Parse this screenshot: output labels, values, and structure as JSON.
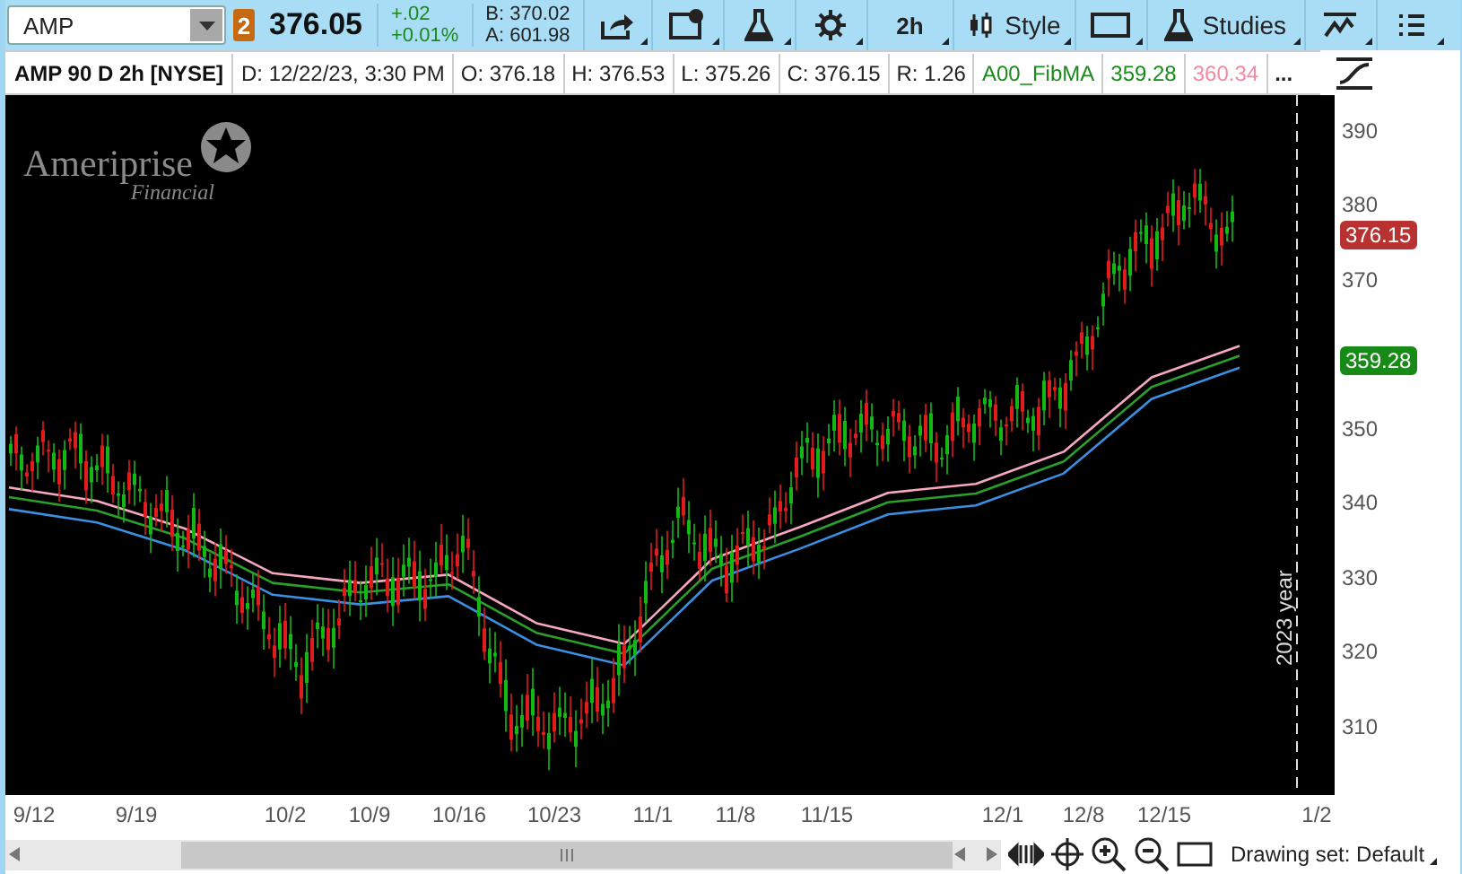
{
  "toolbar": {
    "symbol": "AMP",
    "link_badge": "2",
    "last_price": "376.05",
    "change": "+.02",
    "change_percent": "+0.01%",
    "bid": "B: 370.02",
    "ask": "A: 601.98",
    "period_button": "2h",
    "style_button": "Style",
    "studies_button": "Studies"
  },
  "header": {
    "title": "AMP 90 D 2h [NYSE]",
    "fields": [
      {
        "text": "D: 12/22/23, 3:30 PM",
        "color": "#222222"
      },
      {
        "text": "O: 376.18",
        "color": "#222222"
      },
      {
        "text": "H: 376.53",
        "color": "#222222"
      },
      {
        "text": "L: 375.26",
        "color": "#222222"
      },
      {
        "text": "C: 376.15",
        "color": "#222222"
      },
      {
        "text": "R: 1.26",
        "color": "#222222"
      },
      {
        "text": "A00_FibMA",
        "color": "#1a8a1a"
      },
      {
        "text": "359.28",
        "color": "#1a8a1a"
      },
      {
        "text": "360.34",
        "color": "#f08aa0"
      }
    ],
    "more": "..."
  },
  "chart": {
    "logo_name": "Ameriprise",
    "logo_sub": "Financial",
    "year_marker": "2023 year",
    "chart_data": {
      "type": "line",
      "ylim": [
        301,
        395
      ],
      "yticks": [
        310,
        320,
        330,
        340,
        350,
        370,
        380,
        390
      ],
      "series": [
        {
          "color": "#f7a8c0",
          "values": [
            342.3,
            340.5,
            336.8,
            330.8,
            329.5,
            330.6,
            324.1,
            321.3,
            332.7,
            337.0,
            341.6,
            342.8,
            347.1,
            357.1,
            361.3
          ]
        },
        {
          "color": "#2aa02a",
          "values": [
            341.0,
            339.2,
            335.5,
            329.5,
            328.2,
            329.3,
            322.8,
            320.0,
            331.4,
            335.7,
            340.3,
            341.5,
            345.8,
            355.8,
            360.0
          ]
        },
        {
          "color": "#3b8fe0",
          "values": [
            339.4,
            337.6,
            333.9,
            327.9,
            326.6,
            327.7,
            321.2,
            318.4,
            329.8,
            334.1,
            338.7,
            339.9,
            344.2,
            354.2,
            358.4
          ]
        }
      ]
    },
    "price_tags": [
      {
        "text": "376.15",
        "color": "#b83232"
      },
      {
        "text": "359.28",
        "color": "#178a17"
      }
    ],
    "date_labels": [
      "9/12",
      "9/19",
      "10/2",
      "10/9",
      "10/16",
      "10/23",
      "11/1",
      "11/8",
      "11/15",
      "12/1",
      "12/8",
      "12/15",
      "1/2"
    ]
  },
  "status_bar": {
    "drawing_set": "Drawing set: Default"
  }
}
